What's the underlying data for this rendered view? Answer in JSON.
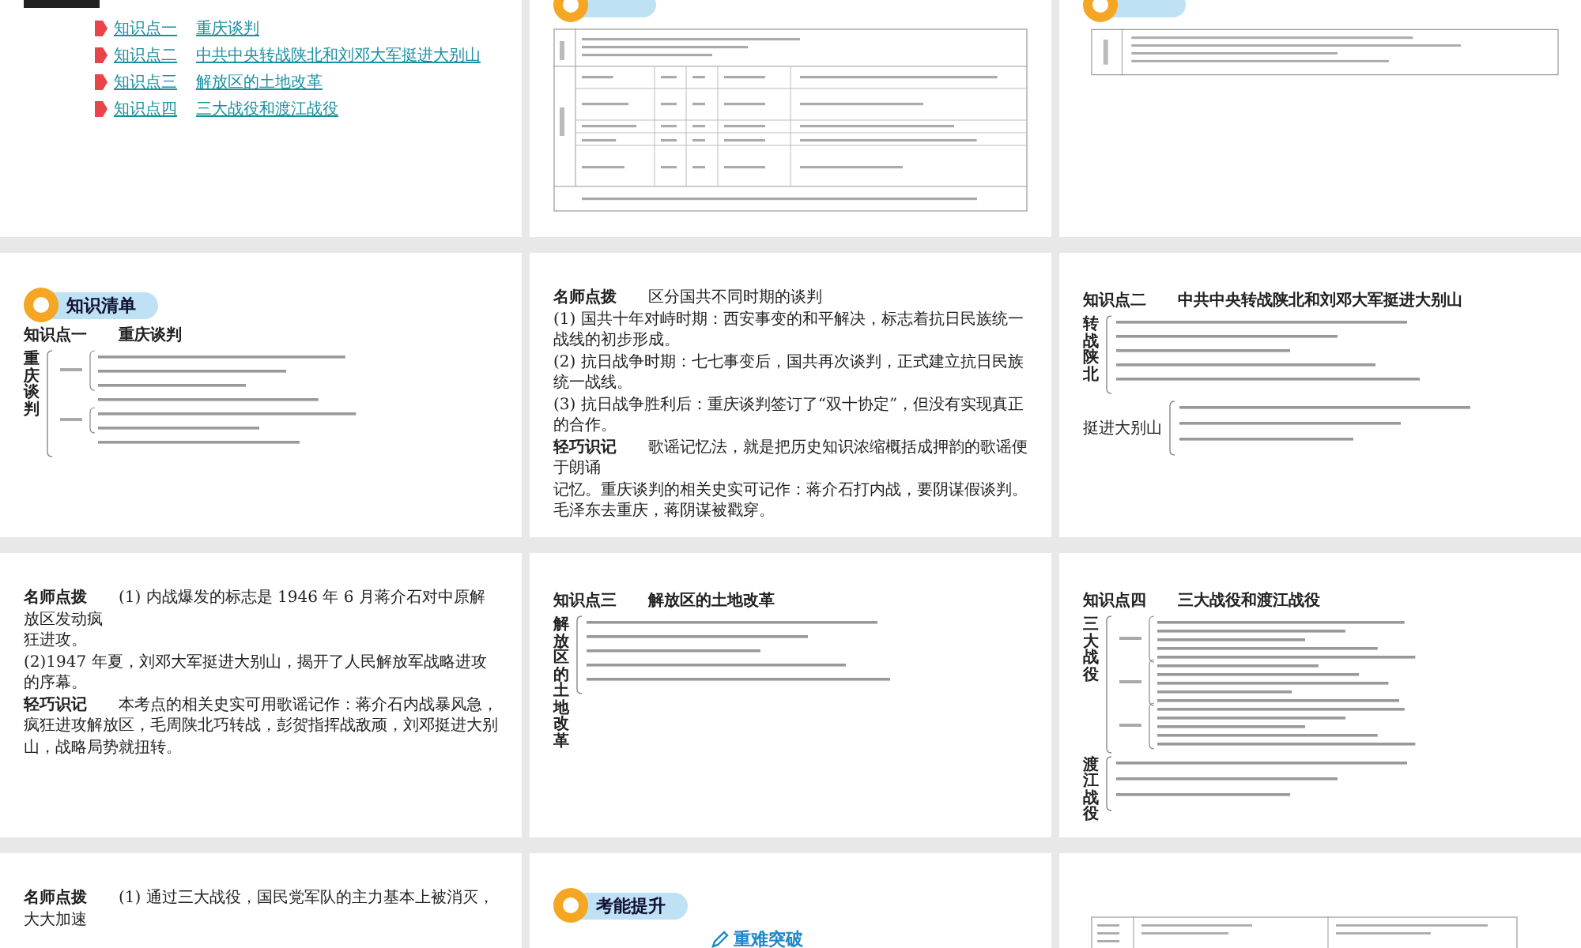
{
  "slides": [
    {
      "kind": "links",
      "banner": true,
      "items": [
        {
          "label": "知识点一",
          "title": "重庆谈判"
        },
        {
          "label": "知识点二",
          "title": "中共中央转战陕北和刘邓大军挺进大别山"
        },
        {
          "label": "知识点三",
          "title": "解放区的土地改革"
        },
        {
          "label": "知识点四",
          "title": "三大战役和渡江战役"
        }
      ]
    },
    {
      "kind": "table",
      "banner": true,
      "table": {
        "kind": "analysis"
      }
    },
    {
      "kind": "table",
      "banner": true,
      "table": {
        "kind": "brief"
      }
    },
    {
      "kind": "tree",
      "tag": "知识清单",
      "heading": {
        "label": "知识点一",
        "title": "重庆谈判"
      },
      "sections": [
        {
          "title": "重庆谈判",
          "vertical": true,
          "kind": "long"
        }
      ]
    },
    {
      "kind": "notes",
      "paragraphs": [
        {
          "lead": "名师点拨",
          "text": "区分国共不同时期的谈判"
        },
        {
          "text": "(1) 国共十年对峙时期：西安事变的和平解决，标志着抗日民族统一战线的初步形成。"
        },
        {
          "text": "(2) 抗日战争时期：七七事变后，国共再次谈判，正式建立抗日民族统一战线。"
        },
        {
          "text": "(3) 抗日战争胜利后：重庆谈判签订了“双十协定”，但没有实现真正的合作。"
        },
        {
          "lead": "轻巧识记",
          "text": "歌谣记忆法，就是把历史知识浓缩概括成押韵的歌谣便于朗诵"
        },
        {
          "text": "记忆。重庆谈判的相关史实可记作：蒋介石打内战，要阴谋假谈判。毛泽东去重庆，蒋阴谋被戳穿。"
        }
      ]
    },
    {
      "kind": "tree",
      "heading": {
        "label": "知识点二",
        "title": "中共中央转战陕北和刘邓大军挺进大别山"
      },
      "sections": [
        {
          "title": "转战陕北",
          "vertical": true,
          "kind": "medium"
        },
        {
          "title": "挺进大别山",
          "vertical": false,
          "kind": "short"
        }
      ]
    },
    {
      "kind": "notes",
      "paragraphs": [
        {
          "lead": "名师点拨",
          "text": "(1) 内战爆发的标志是 1946 年 6 月蒋介石对中原解放区发动疯"
        },
        {
          "text": "狂进攻。"
        },
        {
          "text": "(2)1947 年夏，刘邓大军挺进大别山，揭开了人民解放军战略进攻的序幕。"
        },
        {
          "lead": "轻巧识记",
          "text": "本考点的相关史实可用歌谣记作：蒋介石内战暴风急，疯狂进攻解放区，毛周陕北巧转战，彭贺指挥战敌顽，刘邓挺进大别山，战略局势就扭转。"
        }
      ]
    },
    {
      "kind": "tree",
      "heading": {
        "label": "知识点三",
        "title": "解放区的土地改革"
      },
      "sections": [
        {
          "title": "解放区的土地改革",
          "vertical": true,
          "kind": "medium"
        }
      ]
    },
    {
      "kind": "tree",
      "heading": {
        "label": "知识点四",
        "title": "三大战役和渡江战役"
      },
      "sections": [
        {
          "title": "三大战役",
          "vertical": true,
          "kind": "nested"
        },
        {
          "title": "渡江战役",
          "vertical": true,
          "kind": "short"
        }
      ]
    },
    {
      "kind": "notes",
      "paragraphs": [
        {
          "lead": "名师点拨",
          "text": "(1) 通过三大战役，国民党军队的主力基本上被消灭，大大加速"
        }
      ]
    },
    {
      "kind": "feature",
      "tag": "考能提升",
      "subtitle": "重难突破"
    },
    {
      "kind": "table",
      "banner": false,
      "table": {
        "kind": "summary"
      }
    }
  ]
}
